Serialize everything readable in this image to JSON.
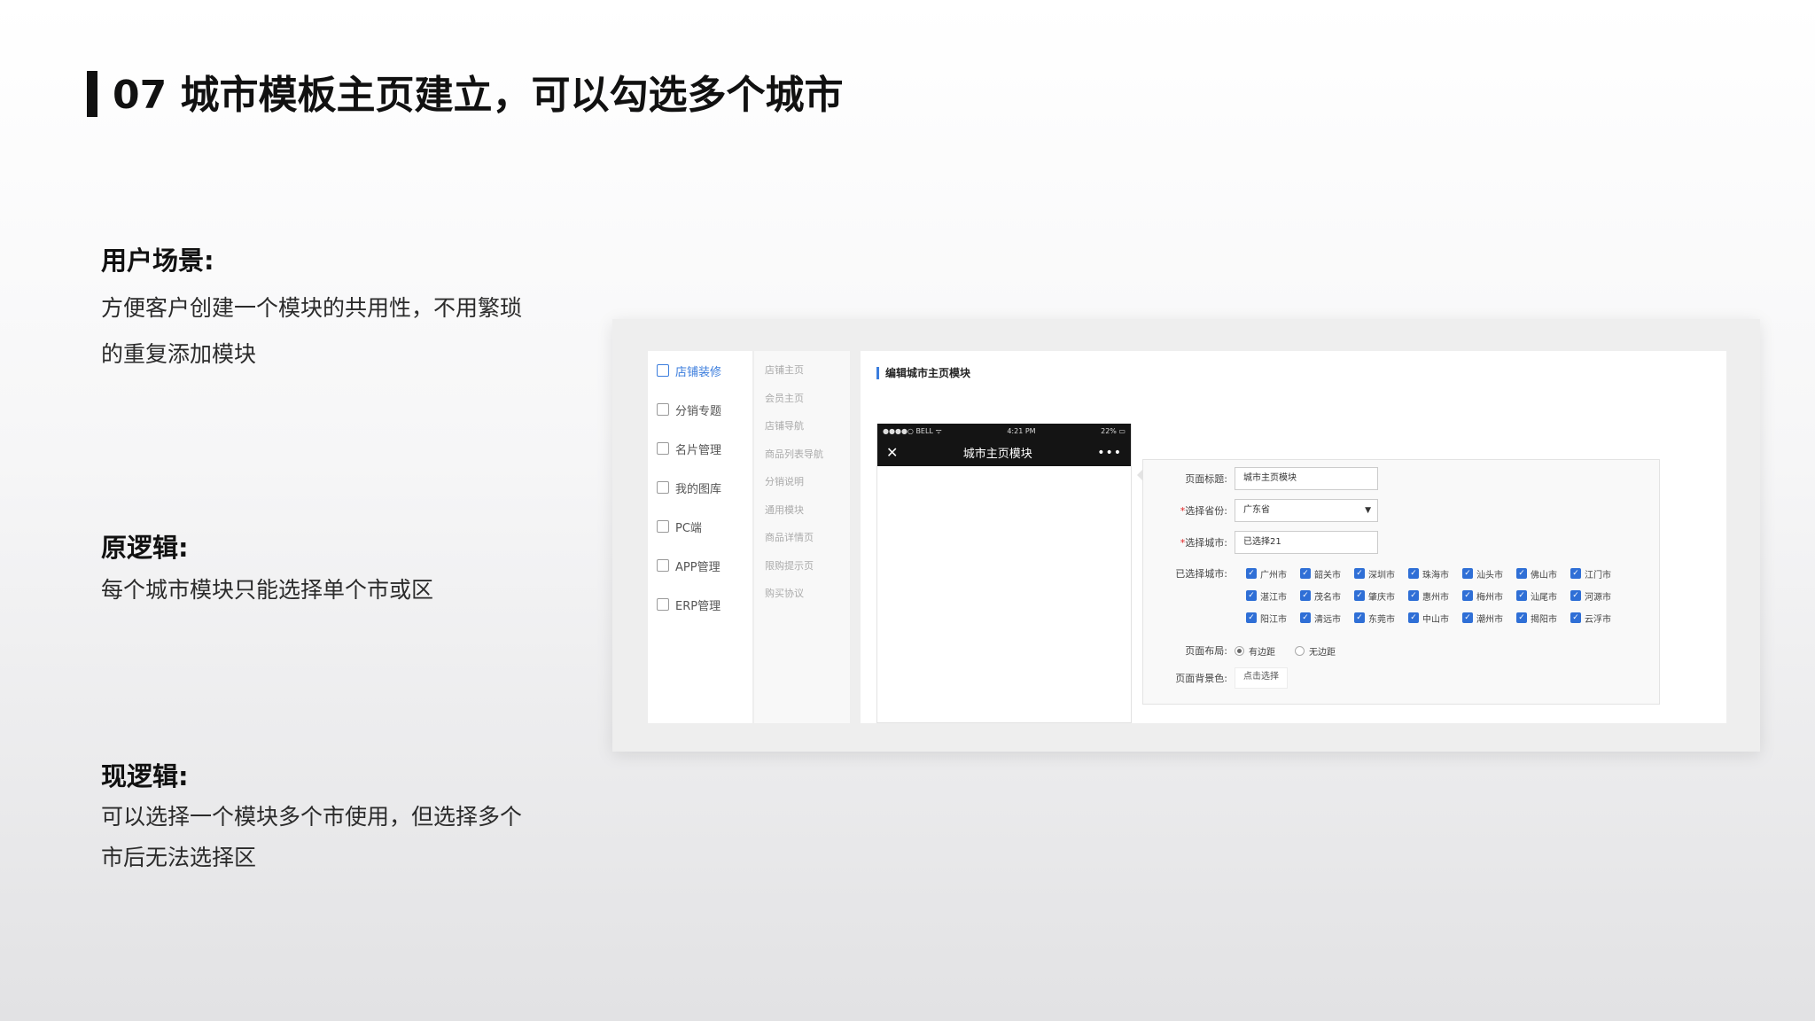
{
  "slide": {
    "title": "07 城市模板主页建立，可以勾选多个城市",
    "sections": [
      {
        "heading": "用户场景:",
        "lines": [
          "方便客户创建一个模块的共用性，不用繁琐",
          "的重复添加模块"
        ]
      },
      {
        "heading": "原逻辑:",
        "lines": [
          "每个城市模块只能选择单个市或区"
        ]
      },
      {
        "heading": "现逻辑:",
        "lines": [
          "可以选择一个模块多个市使用，但选择多个",
          "市后无法选择区"
        ]
      }
    ]
  },
  "screenshot": {
    "sidebar": [
      {
        "label": "店铺装修",
        "icon": "brush-icon",
        "active": true
      },
      {
        "label": "分销专题",
        "icon": "share-icon",
        "active": false
      },
      {
        "label": "名片管理",
        "icon": "card-icon",
        "active": false
      },
      {
        "label": "我的图库",
        "icon": "gallery-icon",
        "active": false
      },
      {
        "label": "PC端",
        "icon": "pc-icon",
        "active": false
      },
      {
        "label": "APP管理",
        "icon": "app-icon",
        "active": false
      },
      {
        "label": "ERP管理",
        "icon": "erp-icon",
        "active": false
      }
    ],
    "subnav": [
      "店铺主页",
      "会员主页",
      "店铺导航",
      "商品列表导航",
      "分销说明",
      "通用模块",
      "商品详情页",
      "限购提示页",
      "购买协议"
    ],
    "edit_title": "编辑城市主页模块",
    "phone": {
      "carrier": "●●●●○ BELL ᯤ",
      "time": "4:21 PM",
      "battery": "22% ▭",
      "close": "✕",
      "title": "城市主页模块",
      "more": "•••"
    },
    "form": {
      "page_title_label": "页面标题:",
      "page_title_value": "城市主页模块",
      "province_label": "选择省份:",
      "province_value": "广东省",
      "province_arrow": "▼",
      "city_label": "选择城市:",
      "city_value": "已选择21",
      "required_mark": "*",
      "selected_label": "已选择城市:",
      "cities": [
        "广州市",
        "韶关市",
        "深圳市",
        "珠海市",
        "汕头市",
        "佛山市",
        "江门市",
        "湛江市",
        "茂名市",
        "肇庆市",
        "惠州市",
        "梅州市",
        "汕尾市",
        "河源市",
        "阳江市",
        "清远市",
        "东莞市",
        "中山市",
        "潮州市",
        "揭阳市",
        "云浮市"
      ],
      "check_mark": "✓",
      "layout_label": "页面布局:",
      "layout_options": [
        "有边距",
        "无边距"
      ],
      "layout_selected": "有边距",
      "bg_label": "页面背景色:",
      "bg_button": "点击选择"
    }
  }
}
